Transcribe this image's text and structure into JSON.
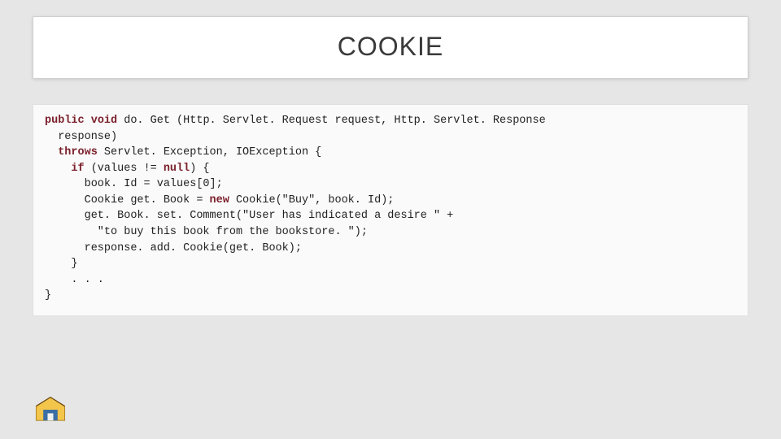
{
  "slide": {
    "title": "COOKIE"
  },
  "code": {
    "l1_kw1": "public",
    "l1_kw2": "void",
    "l1_rest": " do. Get (Http. Servlet. Request request, Http. Servlet. Response",
    "l2": "  response)",
    "l3_kw": "throws",
    "l3_rest": " Servlet. Exception, IOException {",
    "l4_pre": "    ",
    "l4_kw1": "if",
    "l4_mid": " (values != ",
    "l4_kw2": "null",
    "l4_end": ") {",
    "l5": "      book. Id = values[0];",
    "l6_pre": "      Cookie get. Book = ",
    "l6_kw": "new",
    "l6_end": " Cookie(\"Buy\", book. Id);",
    "l7": "      get. Book. set. Comment(\"User has indicated a desire \" +",
    "l8": "        \"to buy this book from the bookstore. \");",
    "l9": "      response. add. Cookie(get. Book);",
    "l10": "    }",
    "l11": "    . . .",
    "l12": "}"
  },
  "logo": {
    "name": "institution-logo"
  }
}
